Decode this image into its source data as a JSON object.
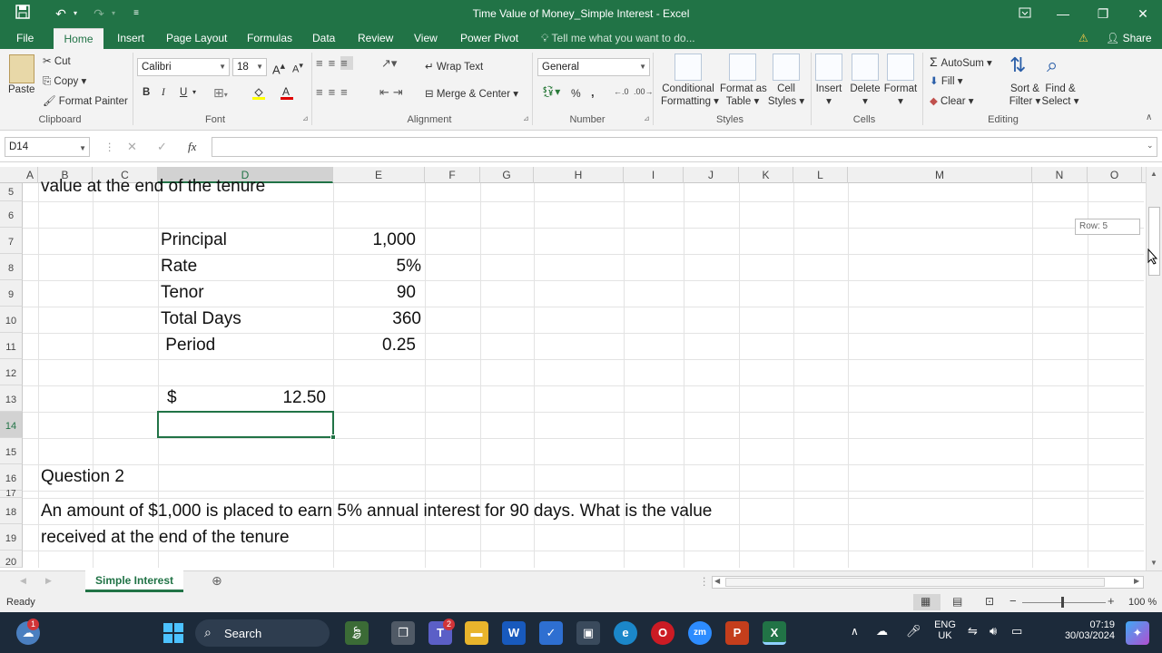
{
  "window": {
    "title": "Time Value of Money_Simple Interest  -  Excel"
  },
  "titlebar_icons": {
    "save": "save-icon",
    "undo": "undo-icon",
    "redo": "redo-icon",
    "customize": "qat-customize-icon"
  },
  "tabs": [
    "File",
    "Home",
    "Insert",
    "Page Layout",
    "Formulas",
    "Data",
    "Review",
    "View",
    "Power Pivot"
  ],
  "tell_me": "Tell me what you want to do...",
  "share": "Share",
  "ribbon": {
    "clipboard": {
      "paste": "Paste",
      "cut": "Cut",
      "copy": "Copy",
      "format_painter": "Format Painter",
      "label": "Clipboard"
    },
    "font": {
      "name": "Calibri",
      "size": "18",
      "bold": "B",
      "italic": "I",
      "underline": "U",
      "label": "Font"
    },
    "alignment": {
      "wrap": "Wrap Text",
      "merge": "Merge & Center",
      "label": "Alignment"
    },
    "number": {
      "format": "General",
      "percent": "%",
      "comma": ",",
      "label": "Number"
    },
    "styles": {
      "conditional": "Conditional",
      "conditional2": "Formatting",
      "format_as": "Format as",
      "format_as2": "Table",
      "cell": "Cell",
      "cell2": "Styles",
      "label": "Styles"
    },
    "cells": {
      "insert": "Insert",
      "delete": "Delete",
      "format": "Format",
      "label": "Cells"
    },
    "editing": {
      "autosum": "AutoSum",
      "fill": "Fill",
      "clear": "Clear",
      "sort": "Sort &",
      "sort2": "Filter",
      "find": "Find &",
      "find2": "Select",
      "label": "Editing"
    }
  },
  "formula_bar": {
    "name_box": "D14",
    "fx": "fx",
    "value": ""
  },
  "columns": [
    "A",
    "B",
    "C",
    "D",
    "E",
    "F",
    "G",
    "H",
    "I",
    "J",
    "K",
    "L",
    "M",
    "N",
    "O"
  ],
  "rows": [
    "5",
    "6",
    "7",
    "8",
    "9",
    "10",
    "11",
    "12",
    "13",
    "14",
    "15",
    "16",
    "17",
    "18",
    "19",
    "20"
  ],
  "cells": {
    "r5": "value at the end of the tenure",
    "principal_label": "Principal",
    "principal_value": "1,000",
    "rate_label": "Rate",
    "rate_value": "5%",
    "tenor_label": "Tenor",
    "tenor_value": "90",
    "days_label": "Total Days",
    "days_value": "360",
    "period_label": " Period",
    "period_value": "0.25",
    "result_currency": "$",
    "result_value": "12.50",
    "q2_title": "Question 2",
    "q2_line1": "An amount of $1,000 is placed to earn 5% annual interest for 90 days. What is the value",
    "q2_line2": "received at the end of the tenure"
  },
  "scroll_tooltip": "Row: 5",
  "sheet_tab": "Simple Interest",
  "status": {
    "ready": "Ready",
    "zoom": "100 %"
  },
  "taskbar": {
    "search": "Search",
    "lang1": "ENG",
    "lang2": "UK",
    "time": "07:19",
    "date": "30/03/2024",
    "badge_weather": "1",
    "badge_teams": "2"
  }
}
